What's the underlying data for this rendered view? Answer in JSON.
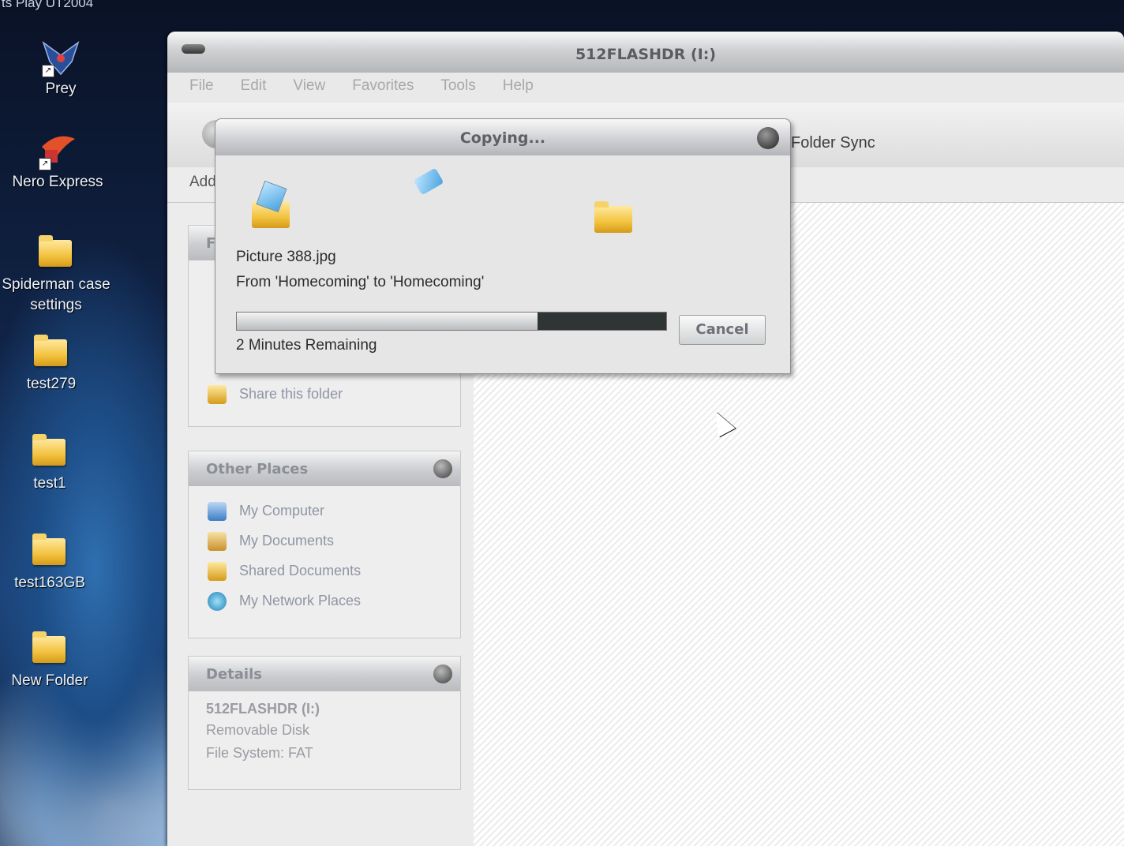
{
  "desktop": {
    "top_text": "ts   Play UT2004",
    "icons": [
      {
        "label": "Prey"
      },
      {
        "label": "Nero Express"
      },
      {
        "label": "Spiderman case settings"
      },
      {
        "label": "test279"
      },
      {
        "label": "test1"
      },
      {
        "label": "test163GB"
      },
      {
        "label": "New Folder"
      }
    ]
  },
  "window": {
    "title": "512FLASHDR (I:)",
    "menu": [
      "File",
      "Edit",
      "View",
      "Favorites",
      "Tools",
      "Help"
    ],
    "toolbar": {
      "folder_sync": "Folder Sync"
    },
    "address_label": "Add",
    "file_tasks_partial": {
      "header": "F",
      "share_item": "Share this folder"
    },
    "other_places": {
      "header": "Other Places",
      "items": [
        "My Computer",
        "My Documents",
        "Shared Documents",
        "My Network Places"
      ]
    },
    "details": {
      "header": "Details",
      "name": "512FLASHDR (I:)",
      "type": "Removable Disk",
      "filesystem": "File System: FAT"
    }
  },
  "dialog": {
    "title": "Copying...",
    "filename": "Picture 388.jpg",
    "from_to": "From 'Homecoming' to 'Homecoming'",
    "progress_fraction": 0.7,
    "time_remaining": "2 Minutes Remaining",
    "cancel_label": "Cancel"
  },
  "colors": {
    "dialog_bg": "#e6e6e6",
    "progress_empty": "#2f3435",
    "link_text": "#8f95a4"
  }
}
